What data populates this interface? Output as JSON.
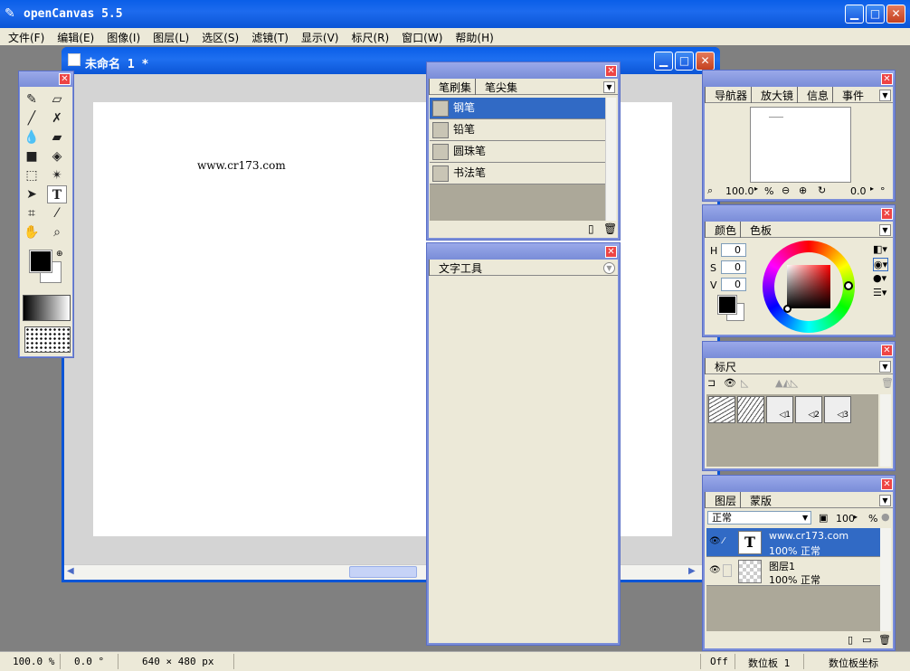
{
  "app": {
    "title": "openCanvas 5.5"
  },
  "menu": [
    "文件(F)",
    "编辑(E)",
    "图像(I)",
    "图层(L)",
    "选区(S)",
    "滤镜(T)",
    "显示(V)",
    "标尺(R)",
    "窗口(W)",
    "帮助(H)"
  ],
  "document": {
    "title": "未命名 1 *",
    "canvas_text": "www.cr173.com"
  },
  "brushes": {
    "tabs": [
      "笔刷集",
      "笔尖集"
    ],
    "items": [
      {
        "label": "钢笔",
        "selected": true
      },
      {
        "label": "铅笔",
        "selected": false
      },
      {
        "label": "圆珠笔",
        "selected": false
      },
      {
        "label": "书法笔",
        "selected": false
      }
    ]
  },
  "text_tool": {
    "tab": "文字工具"
  },
  "navigator": {
    "tabs": [
      "导航器",
      "放大镜",
      "信息",
      "事件"
    ],
    "zoom": "100.0",
    "zoom_unit": "%",
    "angle": "0.0",
    "angle_unit": "°"
  },
  "color": {
    "tabs": [
      "颜色",
      "色板"
    ],
    "h_label": "H",
    "h": "0",
    "s_label": "S",
    "s": "0",
    "v_label": "V",
    "v": "0"
  },
  "ruler": {
    "tab": "标尺",
    "items": [
      "1",
      "2",
      "3"
    ]
  },
  "layers": {
    "tabs": [
      "图层",
      "蒙版"
    ],
    "blend_mode": "正常",
    "opacity": "100",
    "opacity_unit": "%",
    "items": [
      {
        "name": "www.cr173.com",
        "info": "100% 正常",
        "selected": true,
        "type": "text"
      },
      {
        "name": "图层1",
        "info": "100% 正常",
        "selected": false,
        "type": "raster"
      }
    ]
  },
  "status": {
    "zoom": "100.0 %",
    "angle": "0.0 °",
    "size": "640 × 480 px",
    "state": "Off",
    "tablet": "数位板 1",
    "tablet_coord": "数位板坐标"
  },
  "colors": {
    "accent": "#316ac5",
    "titlebar": "#0b55d6",
    "panel": "#ece9d8"
  }
}
